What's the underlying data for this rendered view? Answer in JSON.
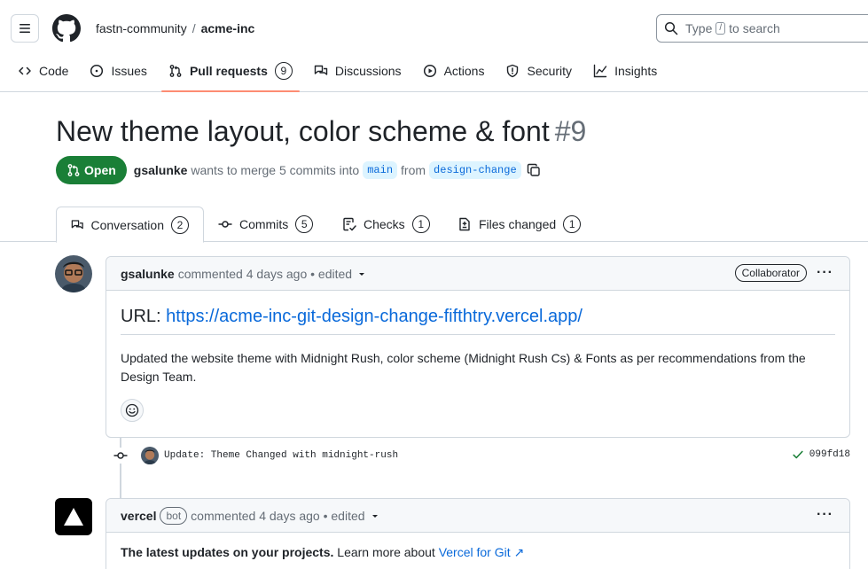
{
  "header": {
    "owner": "fastn-community",
    "separator": "/",
    "repo": "acme-inc",
    "search_prefix": "Type",
    "search_key": "/",
    "search_suffix": "to search"
  },
  "repo_tabs": [
    {
      "label": "Code",
      "icon": "code-icon"
    },
    {
      "label": "Issues",
      "icon": "issue-opened-icon"
    },
    {
      "label": "Pull requests",
      "icon": "git-pull-request-icon",
      "count": "9",
      "selected": true
    },
    {
      "label": "Discussions",
      "icon": "comment-discussion-icon"
    },
    {
      "label": "Actions",
      "icon": "play-icon"
    },
    {
      "label": "Security",
      "icon": "shield-icon"
    },
    {
      "label": "Insights",
      "icon": "graph-icon"
    }
  ],
  "pr": {
    "title": "New theme layout, color scheme & font",
    "number": "#9",
    "state": "Open",
    "author": "gsalunke",
    "merge_text": "wants to merge 5 commits into",
    "base_branch": "main",
    "from_text": "from",
    "head_branch": "design-change"
  },
  "pr_tabs": [
    {
      "label": "Conversation",
      "count": "2",
      "icon": "comment-discussion-icon",
      "selected": true
    },
    {
      "label": "Commits",
      "count": "5",
      "icon": "git-commit-icon"
    },
    {
      "label": "Checks",
      "count": "1",
      "icon": "checklist-icon"
    },
    {
      "label": "Files changed",
      "count": "1",
      "icon": "file-diff-icon"
    }
  ],
  "comment1": {
    "author": "gsalunke",
    "meta": "commented 4 days ago • edited",
    "role": "Collaborator",
    "url_label": "URL:",
    "url": "https://acme-inc-git-design-change-fifthtry.vercel.app/",
    "body": "Updated the website theme with Midnight Rush, color scheme (Midnight Rush Cs) & Fonts as per recommendations from the Design Team."
  },
  "commit": {
    "message": "Update: Theme Changed with midnight-rush",
    "sha": "099fd18"
  },
  "comment2": {
    "author": "vercel",
    "badge": "bot",
    "meta": "commented 4 days ago • edited",
    "bold": "The latest updates on your projects.",
    "text": "Learn more about",
    "link": "Vercel for Git ↗"
  },
  "colors": {
    "open_green": "#1a7f37",
    "link_blue": "#0969da",
    "tab_underline": "#fd8c73"
  }
}
